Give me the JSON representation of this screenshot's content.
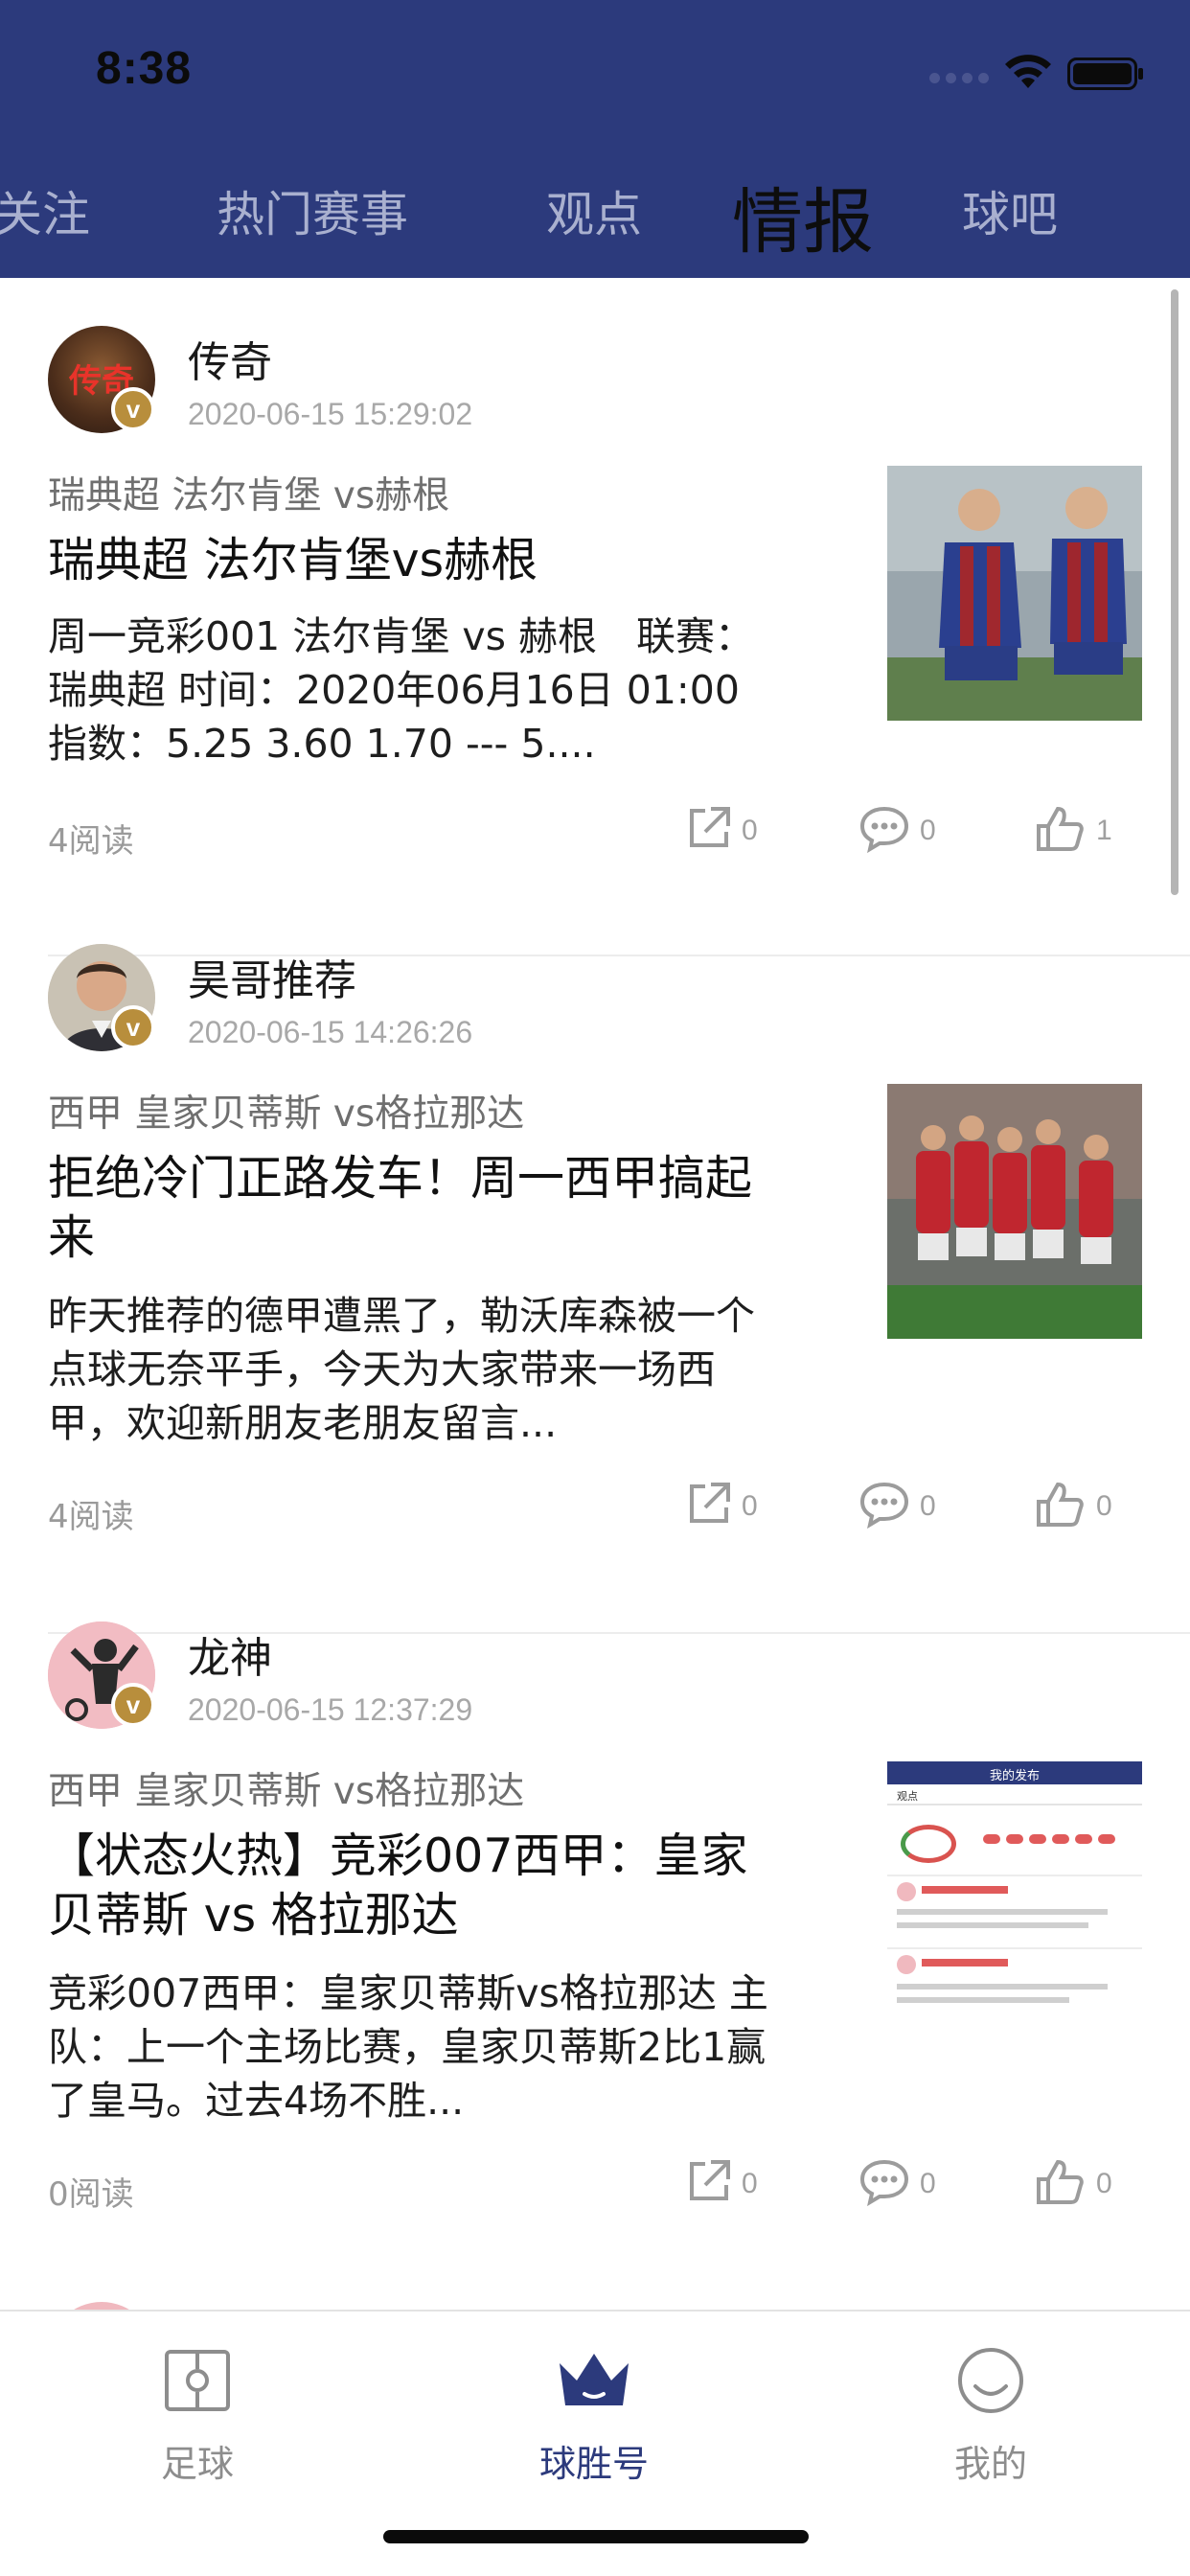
{
  "status_bar": {
    "time": "8:38"
  },
  "top_tabs": [
    {
      "label": "关注"
    },
    {
      "label": "热门赛事"
    },
    {
      "label": "观点"
    },
    {
      "label": "情报",
      "active": true
    },
    {
      "label": "球吧"
    }
  ],
  "posts": [
    {
      "author": "传奇",
      "time": "2020-06-15 15:29:02",
      "match": "瑞典超  法尔肯堡 vs赫根",
      "title": "瑞典超  法尔肯堡vs赫根",
      "excerpt": "周一竞彩001 法尔肯堡 vs 赫根　联赛：瑞典超 时间：2020年06月16日 01:00 指数：5.25 3.60 1.70 --- 5....",
      "reads": "4阅读",
      "shares": "0",
      "comments": "0",
      "likes": "1",
      "avatar_text": "传奇",
      "badge": "v"
    },
    {
      "author": "昊哥推荐",
      "time": "2020-06-15 14:26:26",
      "match": "西甲  皇家贝蒂斯 vs格拉那达",
      "title": "拒绝冷门正路发车！周一西甲搞起来",
      "excerpt": "昨天推荐的德甲遭黑了，勒沃库森被一个点球无奈平手，今天为大家带来一场西甲，欢迎新朋友老朋友留言...",
      "reads": "4阅读",
      "shares": "0",
      "comments": "0",
      "likes": "0",
      "badge": "v"
    },
    {
      "author": "龙神",
      "time": "2020-06-15 12:37:29",
      "match": "西甲  皇家贝蒂斯 vs格拉那达",
      "title": "【状态火热】竞彩007西甲：皇家贝蒂斯 vs 格拉那达",
      "excerpt": "竞彩007西甲：皇家贝蒂斯vs格拉那达 主队：上一个主场比赛，皇家贝蒂斯2比1赢了皇马。过去4场不胜...",
      "reads": "0阅读",
      "shares": "0",
      "comments": "0",
      "likes": "0",
      "badge": "v",
      "thumb_header": "我的发布",
      "thumb_tab": "观点"
    }
  ],
  "bottom_nav": [
    {
      "label": "足球",
      "icon": "football-field-icon"
    },
    {
      "label": "球胜号",
      "icon": "crown-icon",
      "active": true
    },
    {
      "label": "我的",
      "icon": "smiley-icon"
    }
  ],
  "colors": {
    "header_bg": "#2c3a7c",
    "tab_inactive": "#a9b0cf",
    "accent": "#2c3a7c",
    "badge": "#b88e3c"
  }
}
